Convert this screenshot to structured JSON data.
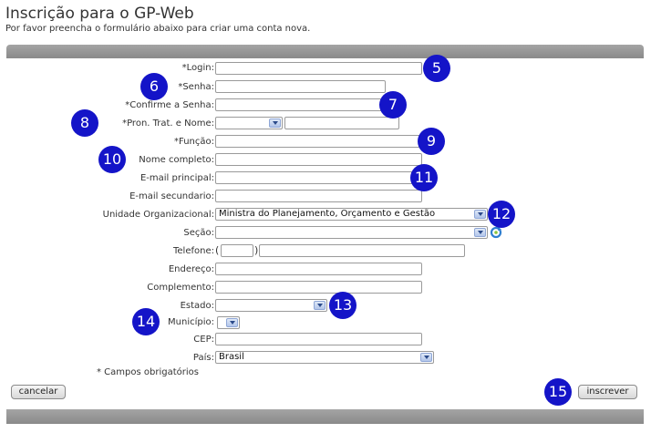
{
  "header": {
    "title": "Inscrição para o GP-Web",
    "subtitle": "Por favor preencha o formulário abaixo para criar uma conta nova."
  },
  "form": {
    "login_label": "*Login:",
    "senha_label": "*Senha:",
    "confirme_label": "*Confirme a Senha:",
    "pron_label": "*Pron. Trat. e Nome:",
    "funcao_label": "*Função:",
    "nome_label": "Nome completo:",
    "email_principal_label": "E-mail principal:",
    "email_secundario_label": "E-mail secundario:",
    "unidade_label": "Unidade Organizacional:",
    "unidade_value": "Ministra do Planejamento, Orçamento e Gestão",
    "secao_label": "Seção:",
    "telefone_label": "Telefone:",
    "endereco_label": "Endereço:",
    "complemento_label": "Complemento:",
    "estado_label": "Estado:",
    "municipio_label": "Município:",
    "cep_label": "CEP:",
    "pais_label": "País:",
    "pais_value": "Brasil",
    "required_note": "* Campos obrigatórios"
  },
  "buttons": {
    "cancel": "cancelar",
    "submit": "inscrever"
  },
  "badges": [
    "5",
    "6",
    "7",
    "8",
    "9",
    "10",
    "11",
    "12",
    "13",
    "14",
    "15"
  ],
  "colors": {
    "badge": "#1414c8",
    "frame": "#999999"
  },
  "icons": {
    "refresh": "refresh-icon",
    "dropdown": "chevron-down-icon"
  }
}
